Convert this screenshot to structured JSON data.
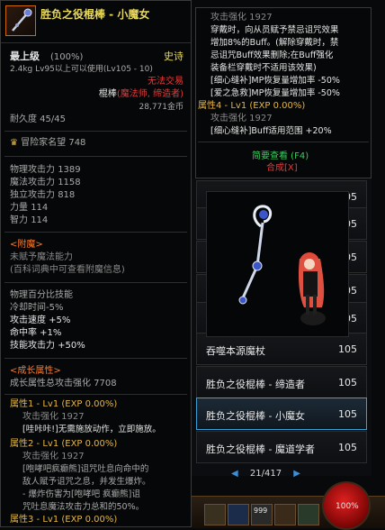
{
  "tooltip": {
    "name": "胜负之役棍棒 - 小魔女",
    "grade": "最上级",
    "grade_pct": "(100%)",
    "rarity": "史诗",
    "weight_req": "2.4kg  Lv95以上可以使用(Lv105 - 10)",
    "trade": "无法交易",
    "type_label": "棍棒",
    "type_class": "(魔法师, 缔造者)",
    "price": "28,771金币",
    "durability": "耐久度 45/45",
    "fame": "冒险家名望 748",
    "stats": [
      {
        "label": "物理攻击力",
        "value": "1389"
      },
      {
        "label": "魔法攻击力",
        "value": "1158"
      },
      {
        "label": "独立攻击力",
        "value": "818"
      },
      {
        "label": "力量",
        "value": "114"
      },
      {
        "label": "智力",
        "value": "114"
      }
    ],
    "enchant_title": "<附魔>",
    "enchant_lines": [
      "未赋予魔法能力",
      "(百科词典中可查看附魔信息)"
    ],
    "pct_title": "物理百分比技能",
    "pct_lines": [
      " 冷却时间-5%",
      "攻击速度 +5%",
      "命中率 +1%",
      "技能攻击力 +50%"
    ],
    "growth_title": "<成长属性>",
    "growth_total": "成长属性总攻击强化 7708",
    "attr1": "属性1 - Lv1 (EXP 0.00%)",
    "attr1_atk": "攻击强化 1927",
    "attr1_desc": "[哇咔咔!]无需施放动作，立即施放。",
    "attr2": "属性2 - Lv1 (EXP 0.00%)",
    "attr2_atk": "攻击强化 1927",
    "attr2_desc": [
      "[咆哮吧疯癫熊]诅咒吐息向命中的",
      "敌人赋予诅咒之息，并发生爆炸。",
      " - 爆炸伤害为[咆哮吧 疯癫熊]诅",
      "咒吐息魔法攻击力总和的50%。"
    ],
    "attr3": "属性3 - Lv1 (EXP 0.00%)"
  },
  "tooltip2": {
    "atk": "攻击强化 1927",
    "desc": [
      "穿戴时，向从员赋予禁忌诅咒效果",
      "增加8%的Buff。(解除穿戴时，禁",
      "忌诅咒Buff效果删除;在Buff强化",
      "装备栏穿戴时不适用该效果)",
      "[细心缝补]MP恢复量增加率 -50%",
      "[爱之急救]MP恢复量增加率 -50%"
    ],
    "attr4": "属性4 - Lv1 (EXP 0.00%)",
    "attr4_atk": "攻击强化 1927",
    "attr4_desc": "[细心缝补]Buff适用范围 +20%",
    "brief": "简要查看 (F4)",
    "synth": "合成[X]"
  },
  "list": {
    "items": [
      {
        "name": "吞噬本源魔杖",
        "level": "105"
      },
      {
        "name": "胜负之役棍棒 - 缔造者",
        "level": "105"
      },
      {
        "name": "胜负之役棍棒 - 小魔女",
        "level": "105"
      },
      {
        "name": "胜负之役棍棒 - 魔道学者",
        "level": "105"
      }
    ],
    "partial_level": "105",
    "pagination": "21/417"
  },
  "hud": {
    "slot_count": "999",
    "orb_label": "100%"
  }
}
